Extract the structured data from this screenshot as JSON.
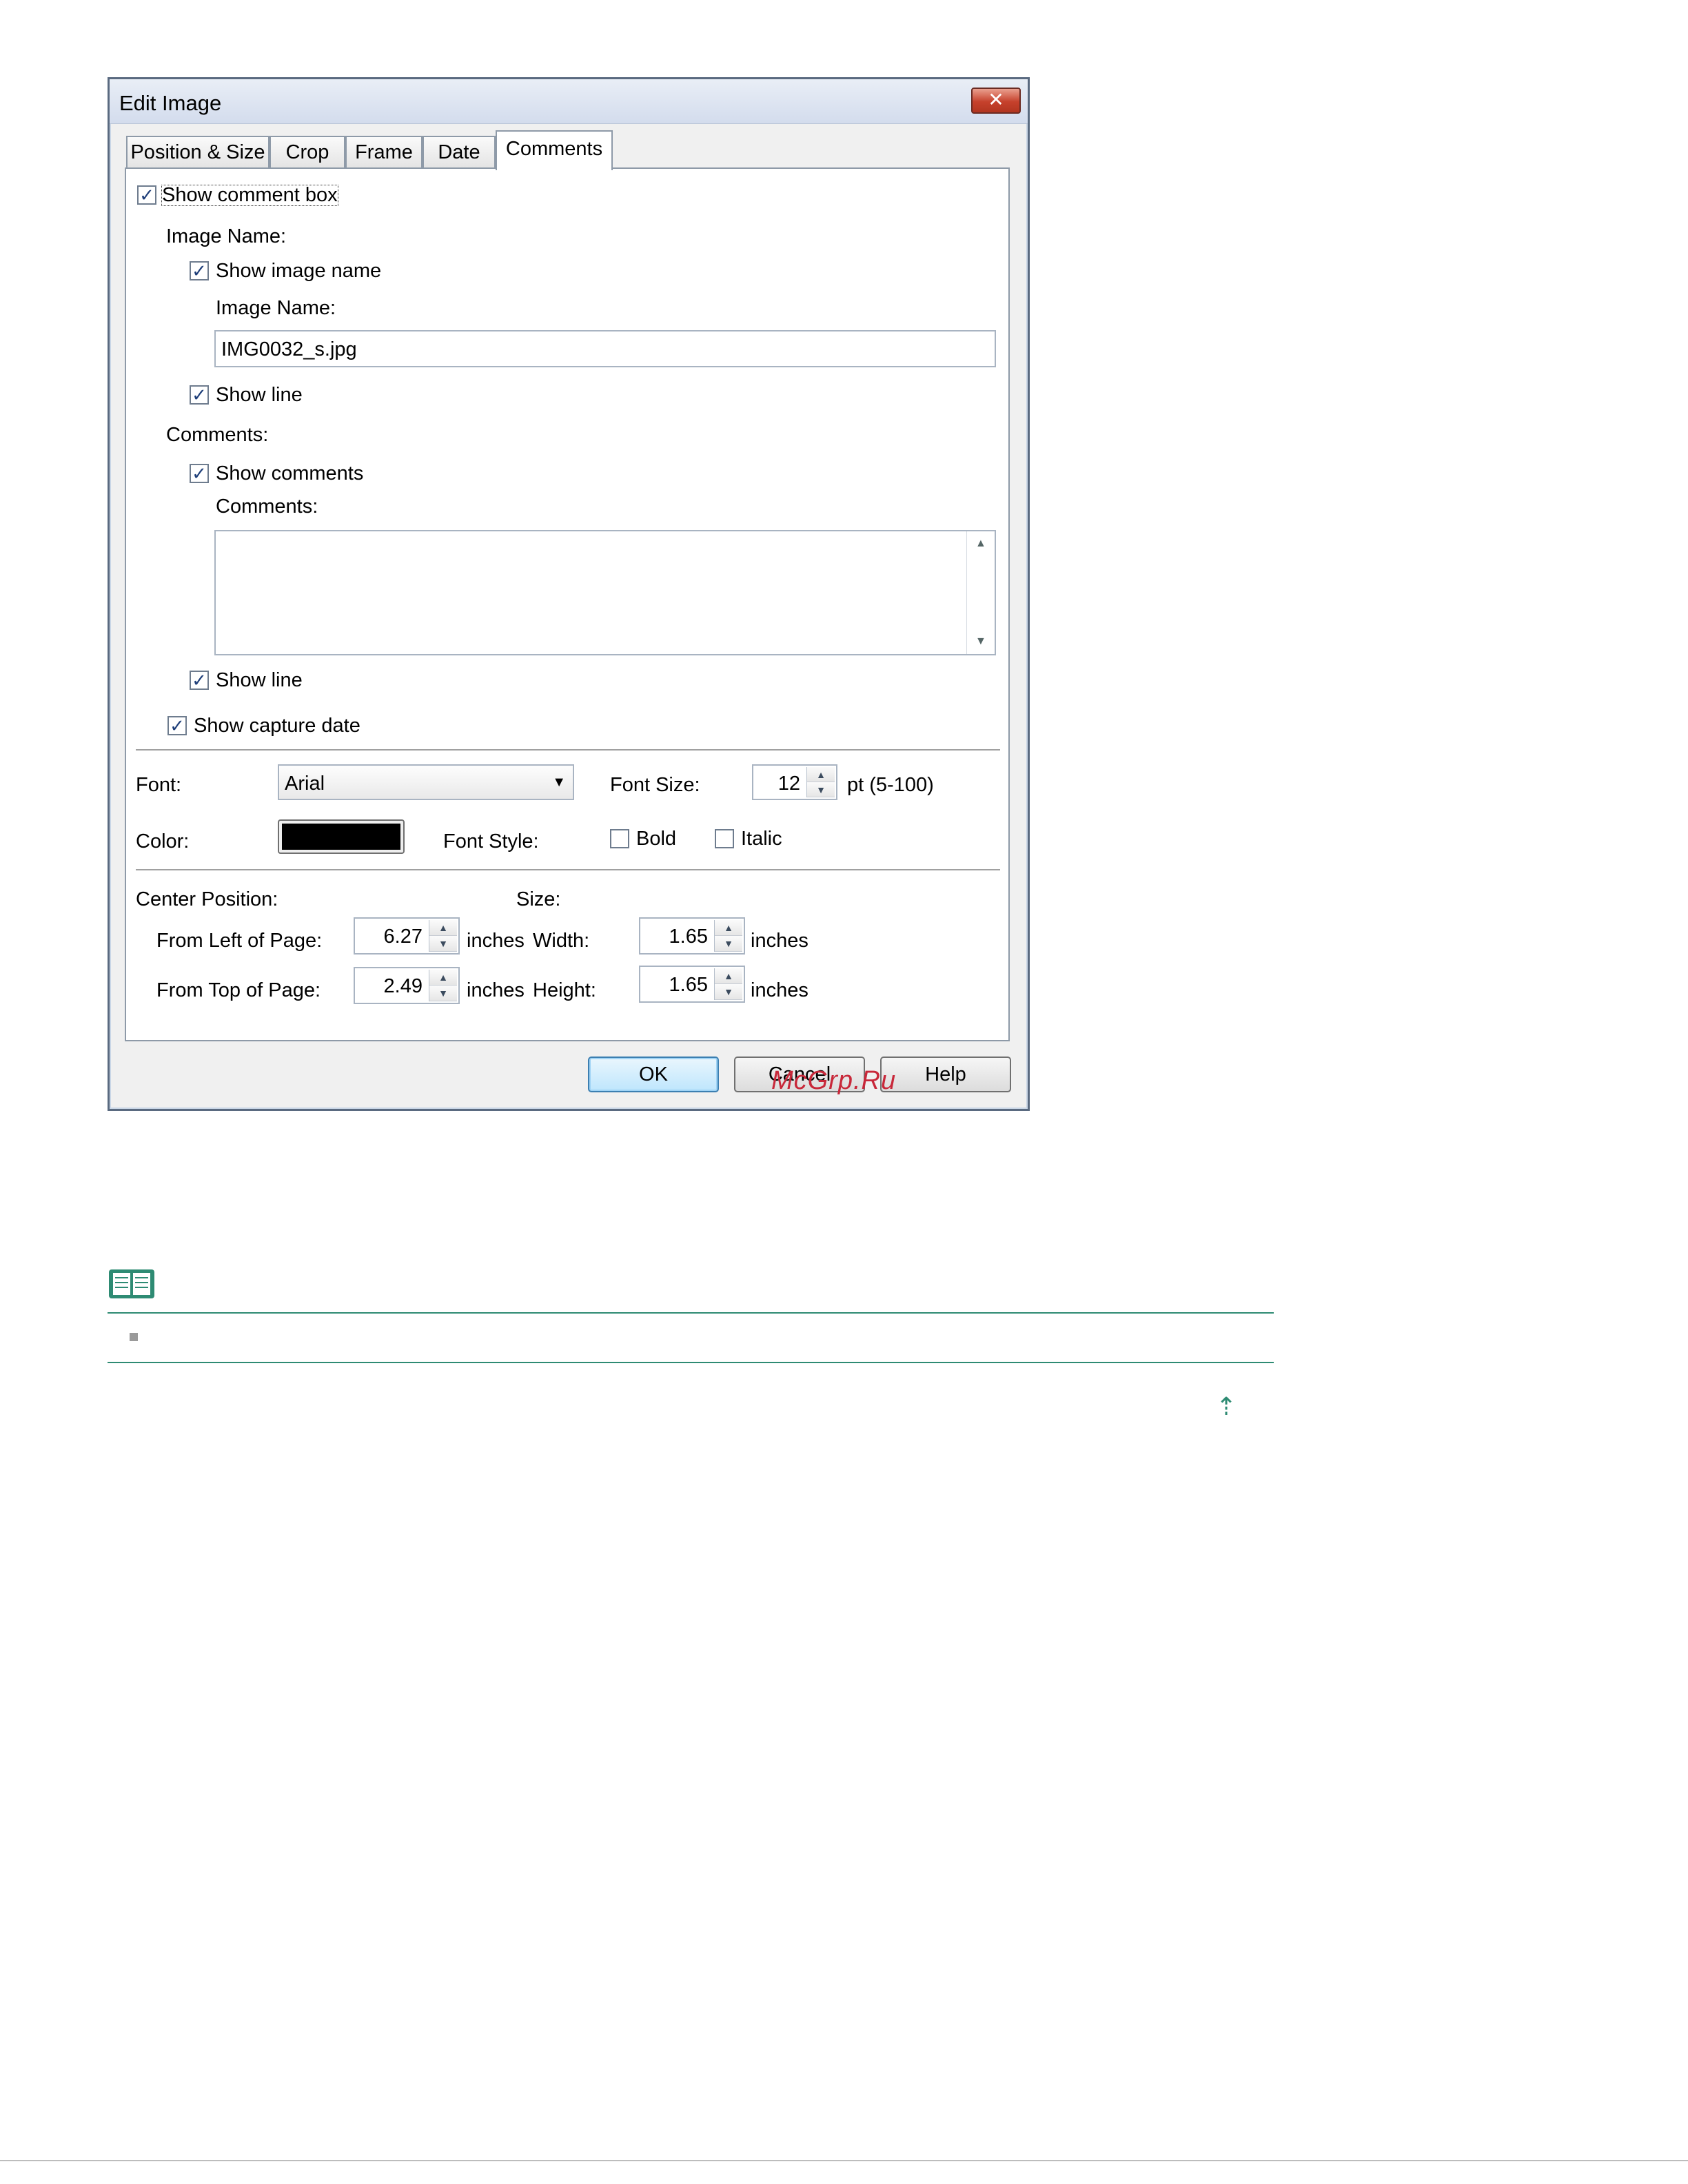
{
  "window": {
    "title": "Edit Image",
    "close_label": "✕"
  },
  "tabs": [
    {
      "label": "Position & Size"
    },
    {
      "label": "Crop"
    },
    {
      "label": "Frame"
    },
    {
      "label": "Date"
    },
    {
      "label": "Comments",
      "active": true
    }
  ],
  "comments_tab": {
    "show_comment_box": {
      "label": "Show comment box",
      "checked": true
    },
    "image_name_section": "Image Name:",
    "show_image_name": {
      "label": "Show image name",
      "checked": true
    },
    "image_name_label": "Image Name:",
    "image_name_value": "IMG0032_s.jpg",
    "image_show_line": {
      "label": "Show line",
      "checked": true
    },
    "comments_section": "Comments:",
    "show_comments": {
      "label": "Show comments",
      "checked": true
    },
    "comments_label": "Comments:",
    "comments_value": "",
    "comments_show_line": {
      "label": "Show line",
      "checked": true
    },
    "show_capture_date": {
      "label": "Show capture date",
      "checked": true
    }
  },
  "font": {
    "font_label": "Font:",
    "font_value": "Arial",
    "font_size_label": "Font Size:",
    "font_size_value": "12",
    "font_size_range": "pt (5-100)",
    "color_label": "Color:",
    "color_value": "#000000",
    "style_label": "Font Style:",
    "bold": {
      "label": "Bold",
      "checked": false
    },
    "italic": {
      "label": "Italic",
      "checked": false
    }
  },
  "position": {
    "center_label": "Center Position:",
    "size_label": "Size:",
    "from_left_label": "From Left of Page:",
    "from_left_value": "6.27",
    "from_top_label": "From Top of Page:",
    "from_top_value": "2.49",
    "width_label": "Width:",
    "width_value": "1.65",
    "height_label": "Height:",
    "height_value": "1.65",
    "unit": "inches"
  },
  "buttons": {
    "ok": "OK",
    "cancel": "Cancel",
    "help": "Help"
  },
  "watermark": "McGrp.Ru",
  "page": {
    "note_icon": "book-note-icon",
    "up_arrow": "⇡",
    "accent_color": "#2e8b73"
  }
}
